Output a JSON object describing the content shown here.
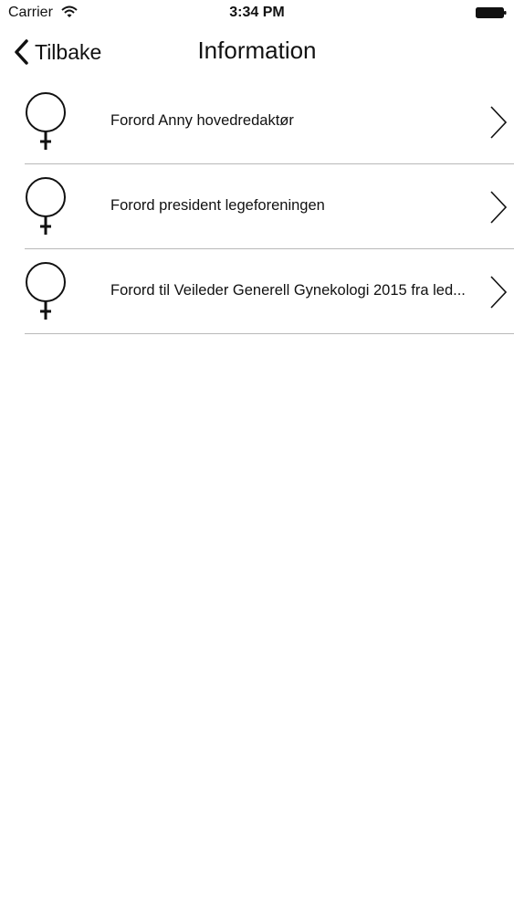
{
  "status_bar": {
    "carrier": "Carrier",
    "time": "3:34 PM",
    "wifi_icon": "wifi-icon",
    "battery_icon": "battery-icon"
  },
  "nav": {
    "back_label": "Tilbake",
    "title": "Information",
    "back_icon": "chevron-left-icon"
  },
  "list": {
    "items": [
      {
        "label": "Forord Anny hovedredaktør",
        "icon": "female-symbol-icon",
        "accessory": "chevron-right-icon"
      },
      {
        "label": "Forord president legeforeningen",
        "icon": "female-symbol-icon",
        "accessory": "chevron-right-icon"
      },
      {
        "label": "Forord til Veileder Generell Gynekologi 2015 fra led...",
        "icon": "female-symbol-icon",
        "accessory": "chevron-right-icon"
      }
    ]
  },
  "colors": {
    "background": "#ffffff",
    "text": "#111111",
    "separator": "#b9b9b9"
  }
}
